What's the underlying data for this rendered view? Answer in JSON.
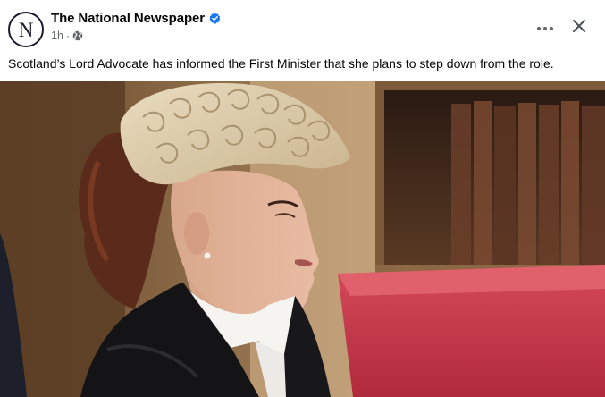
{
  "post": {
    "page_name": "The National Newspaper",
    "avatar_letter": "N",
    "timestamp": "1h",
    "audience_icon": "globe-icon",
    "verified_icon": "verified-badge-icon",
    "text": "Scotland’s Lord Advocate has informed the First Minister that she plans to step down from the role.",
    "photo_icon": "photo"
  },
  "header_actions": {
    "more_icon": "more-horizontal-icon",
    "close_icon": "close-icon"
  },
  "colors": {
    "verified": "#1877f2",
    "secondary_text": "#65676b",
    "primary_text": "#050505"
  }
}
